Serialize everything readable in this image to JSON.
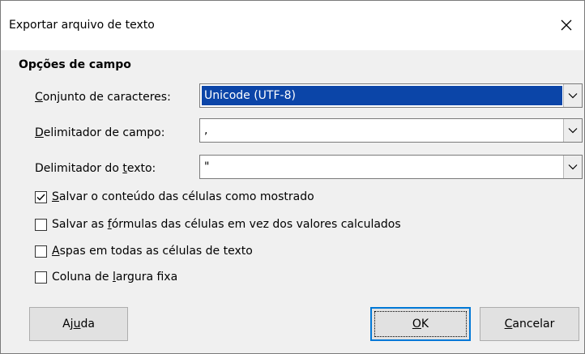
{
  "window": {
    "title": "Exportar arquivo de texto"
  },
  "section": {
    "title": "Opções de campo"
  },
  "fields": {
    "charset": {
      "label_pre": "",
      "label_u": "C",
      "label_post": "onjunto de caracteres:",
      "value": "Unicode (UTF-8)"
    },
    "field_delim": {
      "label_pre": "",
      "label_u": "D",
      "label_post": "elimitador de campo:",
      "value": ","
    },
    "text_delim": {
      "label_pre": "Delimitador do ",
      "label_u": "t",
      "label_post": "exto:",
      "value": "\""
    }
  },
  "options": [
    {
      "pre": "",
      "u": "S",
      "post": "alvar o conteúdo das células como mostrado",
      "checked": true
    },
    {
      "pre": "Salvar as ",
      "u": "f",
      "post": "órmulas das células em vez dos valores calculados",
      "checked": false
    },
    {
      "pre": "",
      "u": "A",
      "post": "spas em todas as células de texto",
      "checked": false
    },
    {
      "pre": "Coluna de ",
      "u": "l",
      "post": "argura fixa",
      "checked": false
    }
  ],
  "buttons": {
    "help": {
      "pre": "Aj",
      "u": "u",
      "post": "da"
    },
    "ok": {
      "pre": "",
      "u": "O",
      "post": "K"
    },
    "cancel": {
      "pre": "",
      "u": "C",
      "post": "ancelar"
    }
  }
}
